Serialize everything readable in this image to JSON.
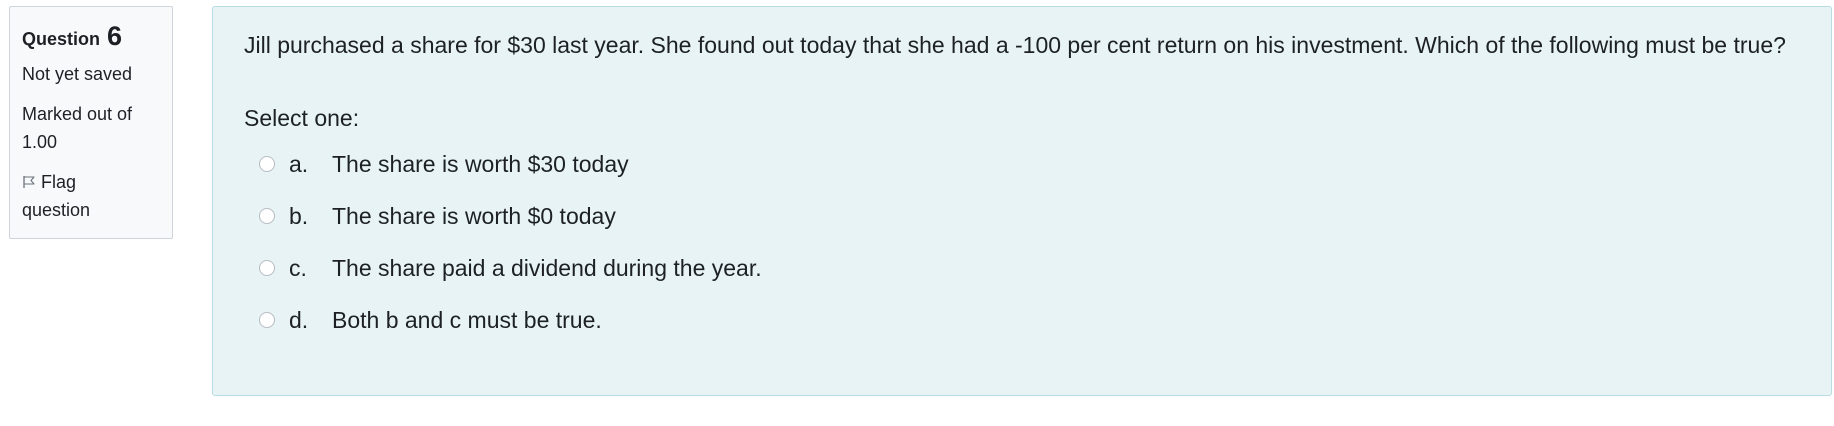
{
  "info": {
    "question_label": "Question",
    "question_number": "6",
    "state": "Not yet saved",
    "grade_line1": "Marked out of",
    "grade_line2": "1.00",
    "flag_line1": "Flag",
    "flag_line2": "question"
  },
  "question": {
    "text": "Jill purchased a share for $30 last year. She found out today that she had a -100 per cent return on his investment. Which of the following must be true?",
    "prompt": "Select one:",
    "answers": [
      {
        "letter": "a.",
        "text": "The share is worth $30 today"
      },
      {
        "letter": "b.",
        "text": "The share is worth $0 today"
      },
      {
        "letter": "c.",
        "text": "The share paid a dividend during the year."
      },
      {
        "letter": "d.",
        "text": "Both b and c must be true."
      }
    ]
  },
  "colors": {
    "content_background": "#e7f3f5",
    "content_border": "#b8dce2",
    "info_background": "#f8f9fa",
    "text": "#1d2125"
  },
  "icons": {
    "flag": "flag-icon",
    "radio": "radio-unselected"
  }
}
